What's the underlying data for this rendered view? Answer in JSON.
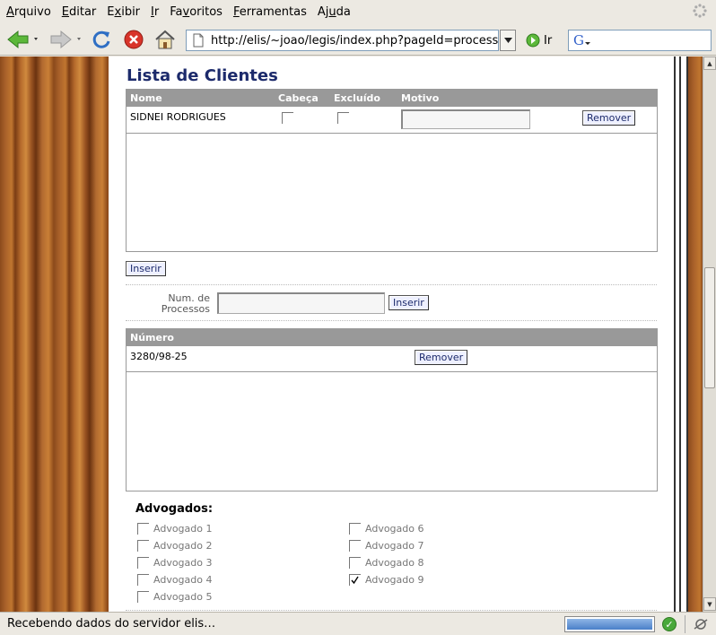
{
  "menu": [
    {
      "pre": "",
      "u": "A",
      "post": "rquivo"
    },
    {
      "pre": "",
      "u": "E",
      "post": "ditar"
    },
    {
      "pre": "E",
      "u": "x",
      "post": "ibir"
    },
    {
      "pre": "",
      "u": "I",
      "post": "r"
    },
    {
      "pre": "Fa",
      "u": "v",
      "post": "oritos"
    },
    {
      "pre": "",
      "u": "F",
      "post": "erramentas"
    },
    {
      "pre": "Aj",
      "u": "u",
      "post": "da"
    }
  ],
  "toolbar": {
    "url": "http://elis/~joao/legis/index.php?pageId=processF",
    "go_label": "Ir"
  },
  "page": {
    "title": "Lista de Clientes",
    "clients": {
      "headers": {
        "nome": "Nome",
        "cabeca": "Cabeça",
        "excluido": "Excluído",
        "motivo": "Motivo"
      },
      "rows": [
        {
          "nome": "SIDNEI RODRIGUES",
          "cabeca": false,
          "excluido": false,
          "motivo": "",
          "remove_label": "Remover"
        }
      ],
      "insert_label": "Inserir"
    },
    "processos": {
      "label_line1": "Num. de",
      "label_line2": "Processos",
      "input_value": "",
      "insert_label": "Inserir",
      "header": "Número",
      "rows": [
        {
          "numero": "3280/98-25",
          "remove_label": "Remover"
        }
      ]
    },
    "advogados": {
      "title": "Advogados:",
      "items": [
        {
          "label": "Advogado 1",
          "checked": false
        },
        {
          "label": "Advogado 2",
          "checked": false
        },
        {
          "label": "Advogado 3",
          "checked": false
        },
        {
          "label": "Advogado 4",
          "checked": false
        },
        {
          "label": "Advogado 5",
          "checked": false
        },
        {
          "label": "Advogado 6",
          "checked": false
        },
        {
          "label": "Advogado 7",
          "checked": false
        },
        {
          "label": "Advogado 8",
          "checked": false
        },
        {
          "label": "Advogado 9",
          "checked": true
        }
      ]
    }
  },
  "status": {
    "text": "Recebendo dados do servidor elis…",
    "progress": 1.0
  },
  "colors": {
    "title": "#1c2a6b",
    "grid_header": "#999999",
    "button_bg": "#eef0ff"
  }
}
